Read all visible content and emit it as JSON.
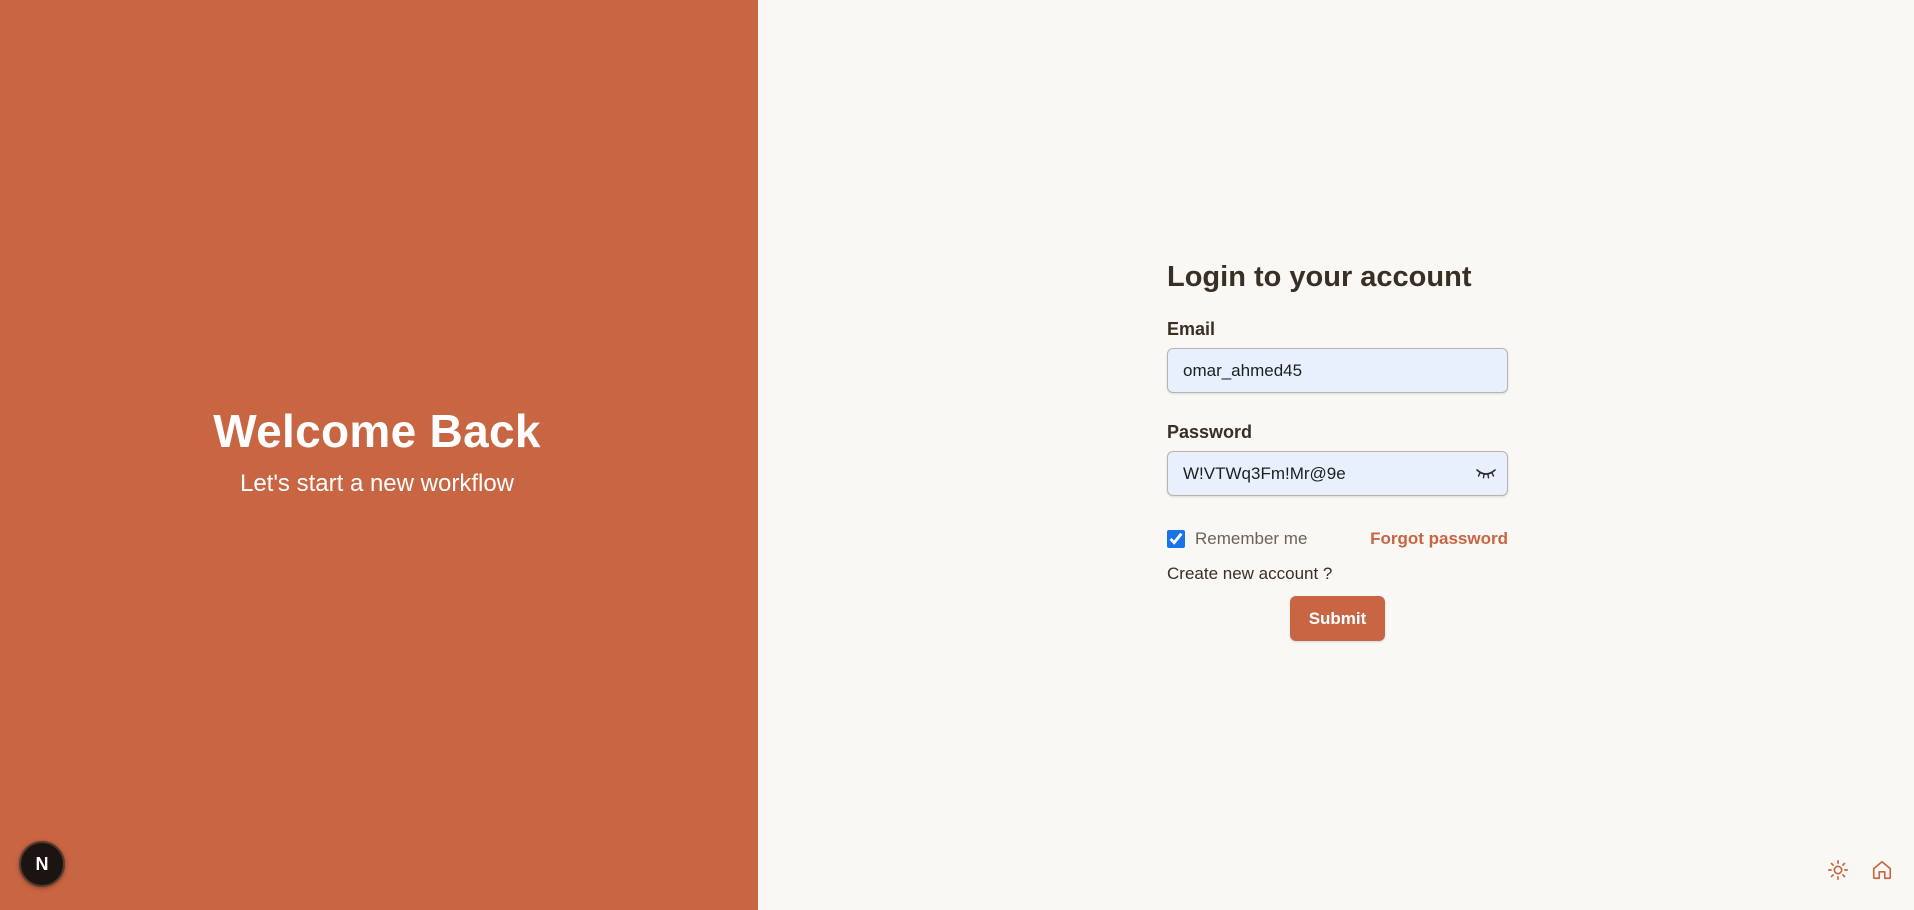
{
  "brand": {
    "welcome_title": "Welcome Back",
    "welcome_subtitle": "Let's start a new workflow",
    "badge_letter": "N",
    "color": "#c86542"
  },
  "login": {
    "title": "Login to your account",
    "email_label": "Email",
    "email_value": "omar_ahmed45",
    "password_label": "Password",
    "password_value": "W!VTWq3Fm!Mr@9e",
    "password_toggle_icon": "eye-closed-icon",
    "remember_label": "Remember me",
    "remember_checked": true,
    "forgot_label": "Forgot password",
    "create_label": "Create new account ?",
    "submit_label": "Submit"
  },
  "corner": {
    "theme_icon": "sun-icon",
    "home_icon": "home-icon"
  },
  "colors": {
    "accent": "#c86542",
    "background": "#f9f8f4",
    "input_fill": "#e8f0fe",
    "text_dark": "#3a2f24",
    "checkbox": "#1a73e8"
  }
}
